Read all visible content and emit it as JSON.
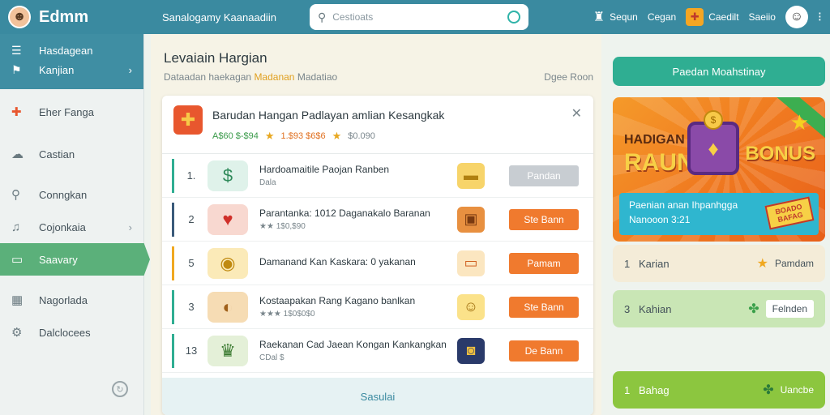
{
  "topbar": {
    "brand": "Edmm",
    "subtitle": "Sanalogamy Kaanaadiin",
    "search_placeholder": "Cestioats",
    "sign_in": "Sequn",
    "login": "Cegan",
    "credits": "Caedilt",
    "settings": "Saeiio",
    "brand_color": "#3a8aa0"
  },
  "sidebar": {
    "head": [
      {
        "label": "Hasdagean",
        "icon": "menu-icon"
      },
      {
        "label": "Kanjian",
        "icon": "flag-icon"
      }
    ],
    "items": [
      {
        "label": "Eher Fanga",
        "icon": "gift-icon"
      },
      {
        "label": "Castian",
        "icon": "cloud-icon"
      },
      {
        "label": "Conngkan",
        "icon": "search-icon"
      },
      {
        "label": "Cojonkaia",
        "icon": "bell-icon"
      },
      {
        "label": "Saavary",
        "icon": "chat-icon"
      },
      {
        "label": "Nagorlada",
        "icon": "calendar-icon"
      },
      {
        "label": "Dalclocees",
        "icon": "gear-icon"
      }
    ],
    "active_color": "#5bb07a"
  },
  "main": {
    "title": "Levaiain Hargian",
    "sub_prefix": "Dataadan haekagan",
    "sub_highlight": "Madanan",
    "sub_suffix": "Madatiao",
    "right_note": "Dgee Roon",
    "panel": {
      "title": "Barudan Hangan Padlayan amlian Kesangkak",
      "meta_green": "A$60 $-$94",
      "meta_orange": "1.$93 $6$6",
      "meta_grey": "$0.090",
      "rows": [
        {
          "rank": "1.",
          "title": "Hardoamaitile Paojan Ranben",
          "sub": "Dala",
          "button": "Pandan",
          "button_style": "grey",
          "bar_color": "#2fae92",
          "icon": "coins-icon",
          "item_icon": "gold-bar-icon"
        },
        {
          "rank": "2",
          "title": "Parantanka: 1012 Daganakalo Baranan",
          "sub": "★★ 1$0,$90",
          "button": "Ste Bann",
          "button_style": "orange",
          "bar_color": "#3a5a7a",
          "icon": "heart-badge-icon",
          "item_icon": "jar-icon"
        },
        {
          "rank": "5",
          "title": "Damanand Kan Kaskara: 0 yakanan",
          "sub": "",
          "button": "Pamam",
          "button_style": "orange",
          "bar_color": "#f0a820",
          "icon": "coin-bag-icon",
          "item_icon": "ticket-icon"
        },
        {
          "rank": "3",
          "title": "Kostaapakan Rang Kagano banlkan",
          "sub": "★★★ 1$0$0$0",
          "button": "Ste Bann",
          "button_style": "orange",
          "bar_color": "#2fae92",
          "icon": "bread-coin-icon",
          "item_icon": "smiley-icon"
        },
        {
          "rank": "13",
          "title": "Raekanan Cad Jaean Kongan Kankangkan",
          "sub": "CDal $",
          "button": "De Bann",
          "button_style": "orange",
          "bar_color": "#2fae92",
          "icon": "crown-coin-icon",
          "item_icon": "can-icon"
        }
      ],
      "footer": "Sasulai"
    }
  },
  "right": {
    "top_button": "Paedan Moahstinay",
    "banner": {
      "hadiah": "HADIGAN",
      "raun": "RAUN",
      "bonus": "BONUS",
      "line1": "Paenian anan Ihpanhgga",
      "line2": "Nanooon 3:21",
      "stamp": "BOADO BAFAG"
    },
    "cards": [
      {
        "num": "1",
        "label": "Karian",
        "value": "Pamdam",
        "icon": "star-icon"
      },
      {
        "num": "3",
        "label": "Kahian",
        "value": "Felnden",
        "icon": "puzzle-icon"
      },
      {
        "num": "1",
        "label": "Bahag",
        "value": "Uancbe",
        "icon": "puzzle-icon"
      }
    ]
  }
}
